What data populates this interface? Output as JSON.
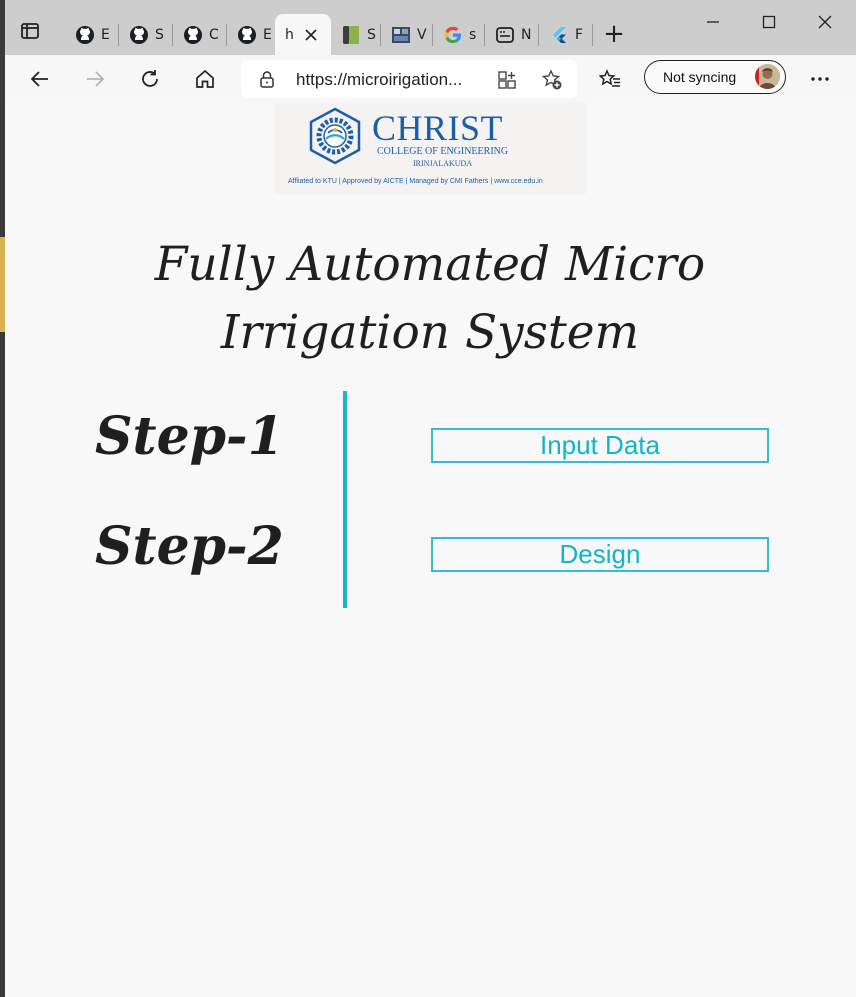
{
  "browser": {
    "tabs": [
      {
        "icon": "github-icon",
        "title": "E"
      },
      {
        "icon": "github-icon",
        "title": "S"
      },
      {
        "icon": "github-icon",
        "title": "C"
      },
      {
        "icon": "github-icon",
        "title": "E"
      },
      {
        "icon": "site-icon",
        "title": "h",
        "active": true
      },
      {
        "icon": "notebook-icon",
        "title": "S"
      },
      {
        "icon": "media-icon",
        "title": "V"
      },
      {
        "icon": "google-icon",
        "title": "s"
      },
      {
        "icon": "app-icon",
        "title": "N"
      },
      {
        "icon": "flutter-icon",
        "title": "F"
      }
    ],
    "new_tab": "+",
    "address": {
      "url": "https://microirigation..."
    },
    "sync": {
      "label": "Not syncing"
    }
  },
  "page": {
    "logo": {
      "name": "CHRIST",
      "line1": "COLLEGE OF ENGINEERING",
      "line2": "IRINJALAKUDA",
      "footer": "Affliated to KTU | Approved by AICTE | Managed by CMI Fathers | www.cce.edu.in"
    },
    "title": "Fully Automated Micro Irrigation System",
    "steps": [
      {
        "label": "Step-1",
        "button": "Input Data"
      },
      {
        "label": "Step-2",
        "button": "Design"
      }
    ]
  },
  "colors": {
    "accent": "#1ab6cc",
    "brand": "#1b5ea8"
  }
}
